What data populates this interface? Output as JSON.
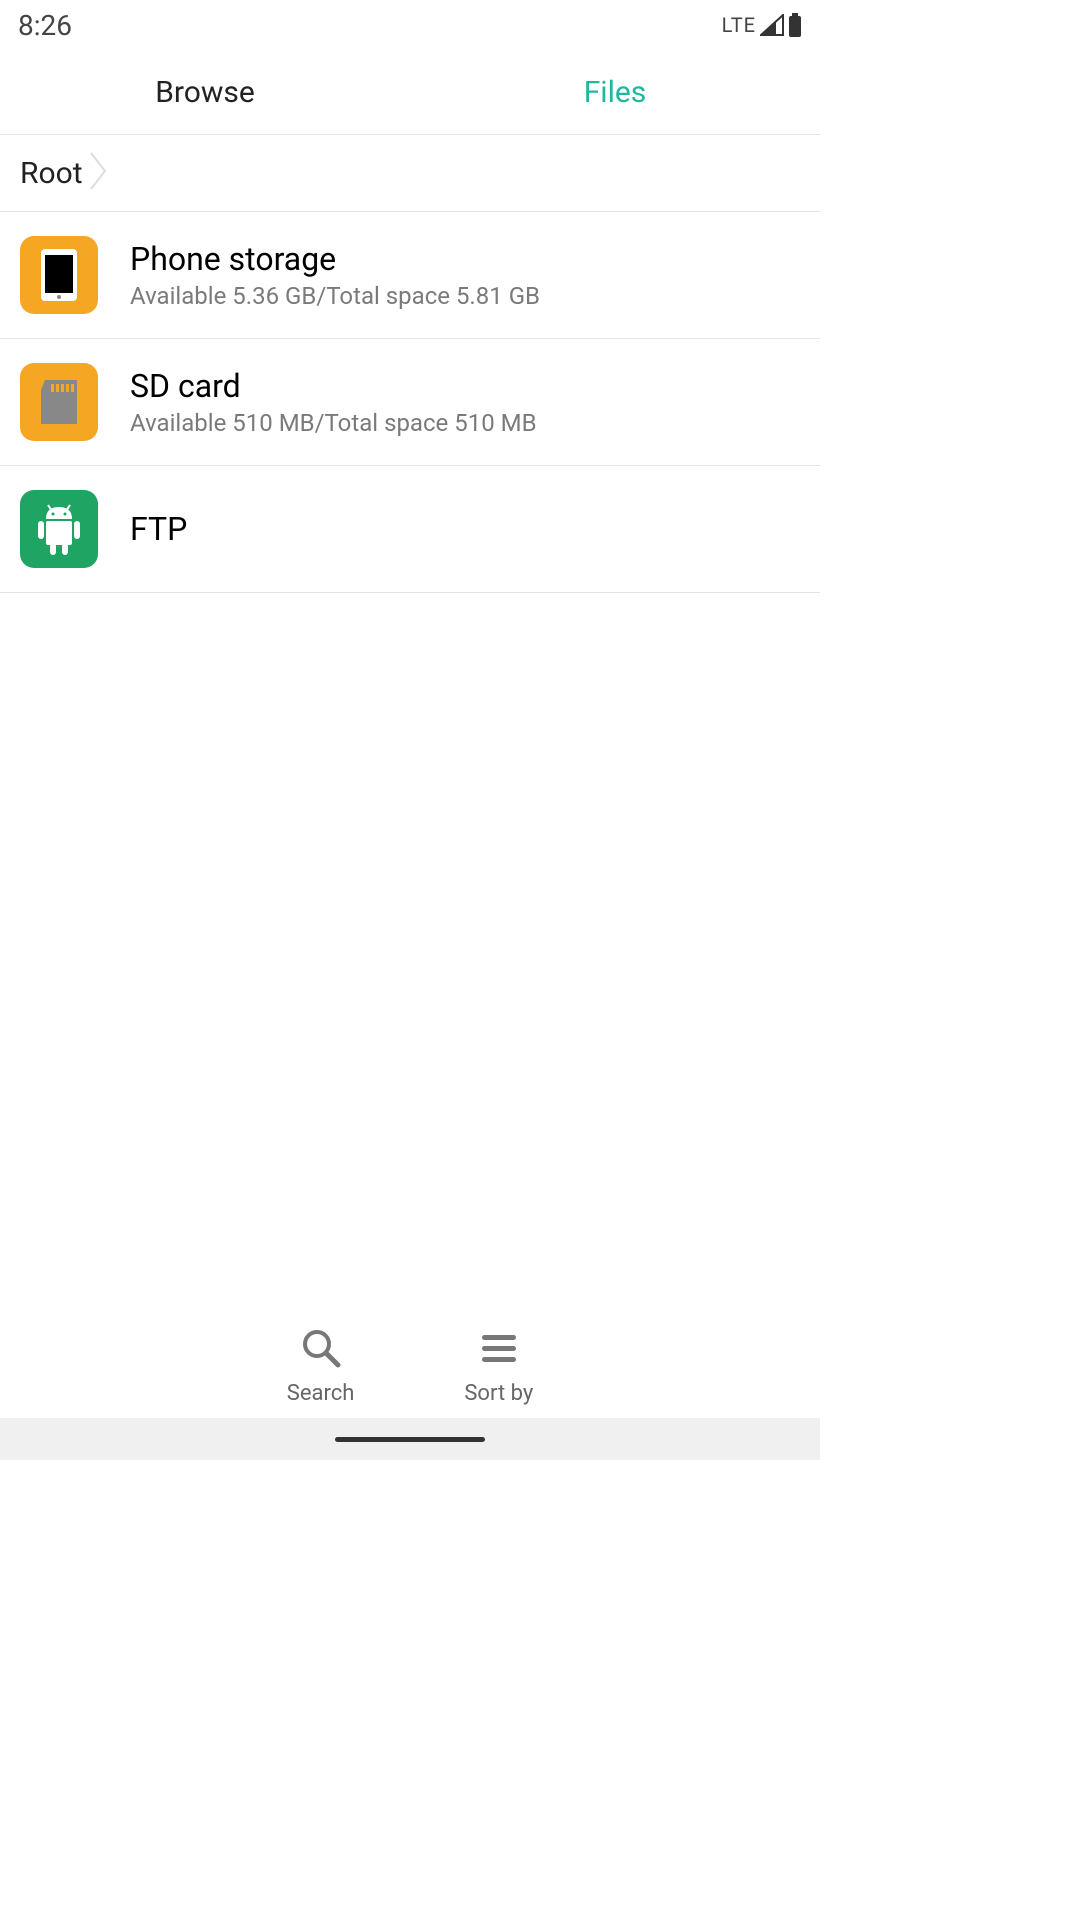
{
  "status": {
    "time": "8:26",
    "network": "LTE"
  },
  "tabs": {
    "browse": "Browse",
    "files": "Files"
  },
  "breadcrumb": {
    "root": "Root"
  },
  "storage": [
    {
      "title": "Phone storage",
      "subtitle": "Available 5.36 GB/Total space 5.81 GB"
    },
    {
      "title": "SD card",
      "subtitle": "Available 510 MB/Total space 510 MB"
    },
    {
      "title": "FTP",
      "subtitle": ""
    }
  ],
  "bottom": {
    "search": "Search",
    "sort": "Sort by"
  }
}
